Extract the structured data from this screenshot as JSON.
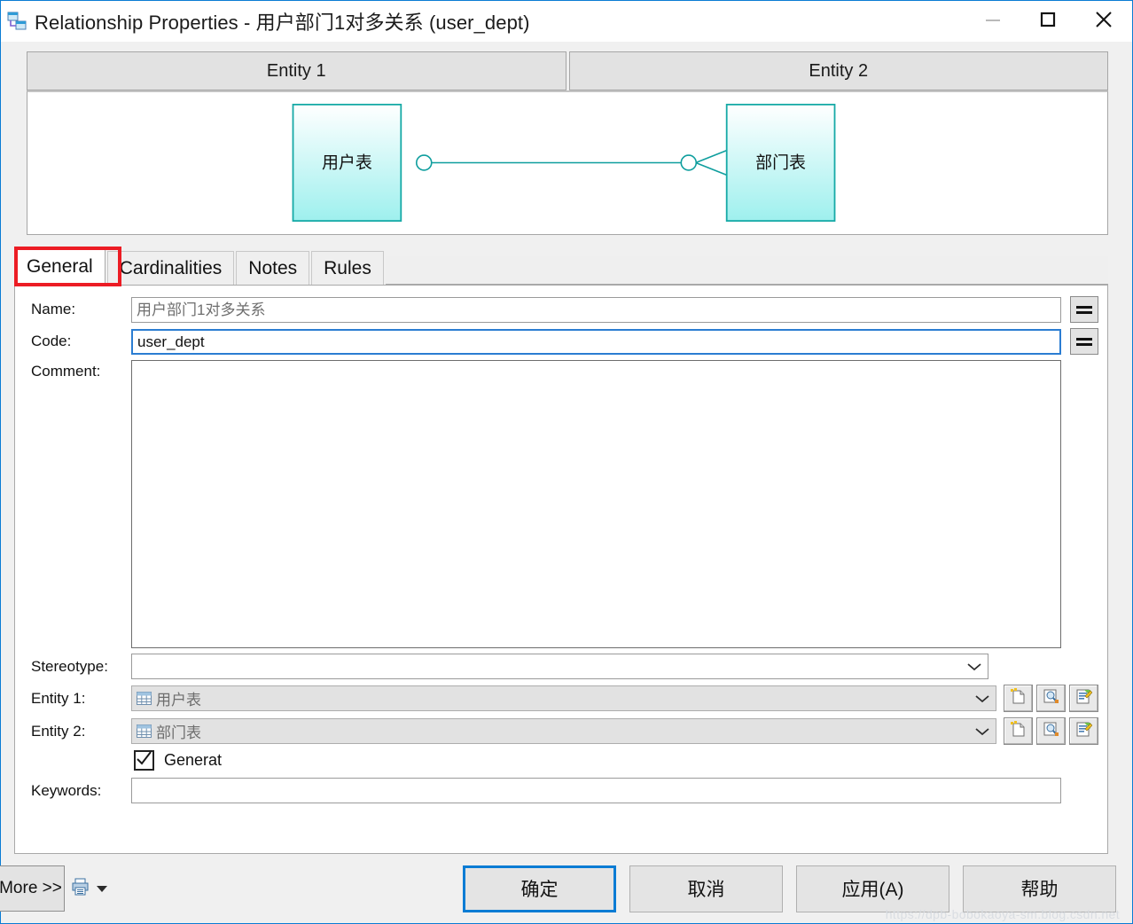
{
  "window": {
    "title": "Relationship Properties - 用户部门1对多关系 (user_dept)",
    "app_icon": "relationship-icon",
    "controls": {
      "minimize": "minimize-icon",
      "maximize": "maximize-icon",
      "close": "close-icon"
    }
  },
  "diagram": {
    "headers": [
      "Entity 1",
      "Entity 2"
    ],
    "entity1_label": "用户表",
    "entity2_label": "部门表",
    "line_color": "#0f9e9e",
    "entity_fill_top": "#ffffff",
    "entity_fill_bottom": "#9ef0ee",
    "notation": "crow-foot",
    "cardinality_left": "one",
    "cardinality_right": "many"
  },
  "tabs": [
    {
      "label": "General",
      "active": true
    },
    {
      "label": "Cardinalities",
      "active": false
    },
    {
      "label": "Notes",
      "active": false
    },
    {
      "label": "Rules",
      "active": false
    }
  ],
  "highlight_color": "#ec1c24",
  "form": {
    "name": {
      "label": "Name:",
      "value": "用户部门1对多关系",
      "readonly": true
    },
    "code": {
      "label": "Code:",
      "value": "user_dept",
      "focused": true
    },
    "comment": {
      "label": "Comment:",
      "value": ""
    },
    "stereotype": {
      "label": "Stereotype:",
      "value": ""
    },
    "entity1": {
      "label": "Entity 1:",
      "value": "用户表",
      "disabled": true
    },
    "entity2": {
      "label": "Entity 2:",
      "value": "部门表",
      "disabled": true
    },
    "generate": {
      "label": "Generat",
      "checked": true
    },
    "keywords": {
      "label": "Keywords:",
      "value": ""
    },
    "equals_button_label": "=",
    "row_buttons": [
      "new-object-icon",
      "browse-object-icon",
      "properties-icon"
    ]
  },
  "footer": {
    "more": "More >>",
    "print_icon": "print-icon",
    "buttons": [
      {
        "label": "确定",
        "default": true
      },
      {
        "label": "取消",
        "default": false
      },
      {
        "label": "应用(A)",
        "default": false
      },
      {
        "label": "帮助",
        "default": false
      }
    ]
  },
  "watermark": "https://dpb-bobokaoya-sm.blog.csdn.net"
}
